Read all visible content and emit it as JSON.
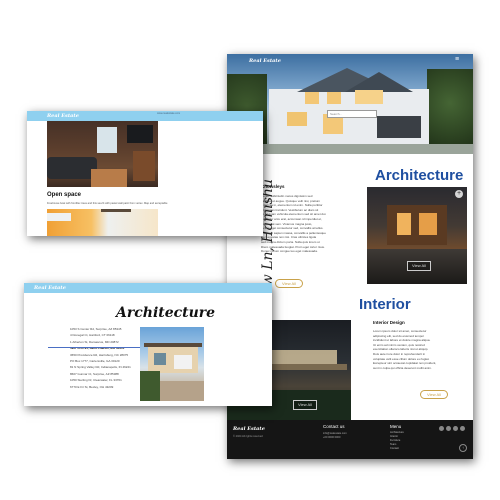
{
  "brand": "Real Estate",
  "card_left_top": {
    "url": "www.realestate.com",
    "section_title": "Open space",
    "section_desc": "Freehouse boat with frontflex trees and this sea fit with pastel wall paint from vertex. Map and acceptable",
    "vertical_text": "Hounslow Ln, Hamishu"
  },
  "card_left_bottom": {
    "title": "Architecture",
    "addresses": [
      "1053 S Center Rd, Surprise, AZ 85345",
      "4 Donegal Ct, Hartford, CT 06118",
      "1 Atherton St, Damascus, MD 20872",
      "5927 N Rt 94, Saint Charles, MO 63301",
      "3650 Providence Rd, Harrisburg, NC 28075",
      "PO Box 1777, Cartersville, GA 30120",
      "81 N Spring Valley Rd, Indianapolis, IN 46221",
      "8607 Gunnar Ct, Surprise, AZ 85388",
      "1050 Sterling Dr, Clearwater, FL 33761",
      "6770 E Fir St, Bexley, OH 43209"
    ],
    "highlight_index": 3
  },
  "card_right": {
    "hero_menu": "≡",
    "search_placeholder": "Search...",
    "side_heading": "Knowsleys",
    "side_paragraphs": [
      "Donec sollicitudin metus dignissim sed",
      "dapibus et augue. Quisque velit nisi, pretium",
      "ut lacinia in, elementum id enim. Nulla porttitor",
      "accumsan tincidunt. Vestibulum ac diam sit",
      "amet quam vehicula elementum sed sit amet dui.",
      "Curabitur arcu erat, accumsan id imperdiet et,",
      "porttitor at sem. Vivamus magna justo,",
      "lacinia eget consectetur sed, convallis at tellus.",
      "Praesent sapien massa, convallis a pellentesque",
      "nec, egestas non nisi. Cras ultricies ligula",
      "sed magna dictum porta. Nulla quis lorem ut",
      "libero malesuada feugiat. Proin eget tortor risus.",
      "Donec rutrum congue leo eget malesuada."
    ],
    "side_button": "View All",
    "arch_title": "Architecture",
    "arch_button": "View All",
    "interior_title": "Interior",
    "interior_heading": "Interior Design",
    "interior_paragraphs": [
      "Lorem ipsum dolor sit amet, consectetur",
      "adipiscing elit, sed do eiusmod tempor",
      "incididunt ut labore et dolore magna aliqua.",
      "Ut enim ad minim veniam, quis nostrud",
      "exercitation ullamco laboris nisi ut aliquip.",
      "Duis aute irure dolor in reprehenderit in",
      "voluptate velit esse cillum dolore eu fugiat.",
      "Excepteur sint occaecat cupidatat non proident,",
      "sunt in culpa qui officia deserunt mollit anim."
    ],
    "interior_button": "View All",
    "dark_button": "View All",
    "footer": {
      "brand": "Real Estate",
      "brand_sub": "© 2024 All rights reserved",
      "contact_title": "Contact us",
      "contact_lines": [
        "info@realestate.com",
        "+00 0000 0000"
      ],
      "menu_title": "Menu",
      "menu_items": [
        "Architecture",
        "Interior",
        "Furniture",
        "Team",
        "Contact"
      ]
    }
  },
  "colors": {
    "accent_blue": "#1f4fa0",
    "sky_header": "#8fd0ef",
    "gold": "#c9a24a",
    "footer_bg": "#151515"
  }
}
